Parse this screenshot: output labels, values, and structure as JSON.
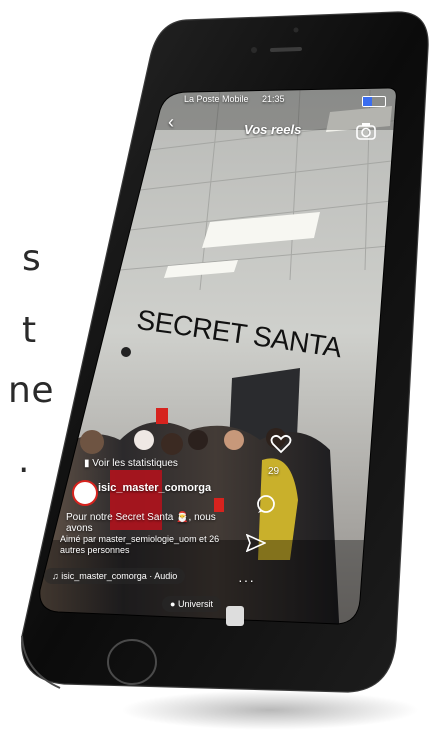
{
  "background_text": {
    "line1": "s",
    "line2": "t",
    "line3": "ne",
    "line4": "."
  },
  "status_bar": {
    "carrier": "La Poste Mobile",
    "time": "21:35"
  },
  "header": {
    "title": "Vos reels"
  },
  "video": {
    "wall_sign": "SECRET SANTA"
  },
  "overlay": {
    "stats_label": "Voir les statistiques",
    "username": "isic_master_comorga",
    "caption": "Pour notre Secret Santa 🎅, nous avons",
    "liked_by": "Aimé par master_semiologie_uom et 26 autres personnes",
    "audio_label": "isic_master_comorga · Audio",
    "location": "Universit",
    "like_count": "29"
  },
  "colors": {
    "phone": "#0d0d0d",
    "accent": "#3a6df0",
    "wall": "#d9d9d6",
    "ceiling": "#bfc0bd"
  },
  "icons": [
    "back-icon",
    "camera-icon",
    "heart-icon",
    "comment-icon",
    "send-icon",
    "more-icon",
    "music-icon",
    "location-icon",
    "stats-icon"
  ]
}
